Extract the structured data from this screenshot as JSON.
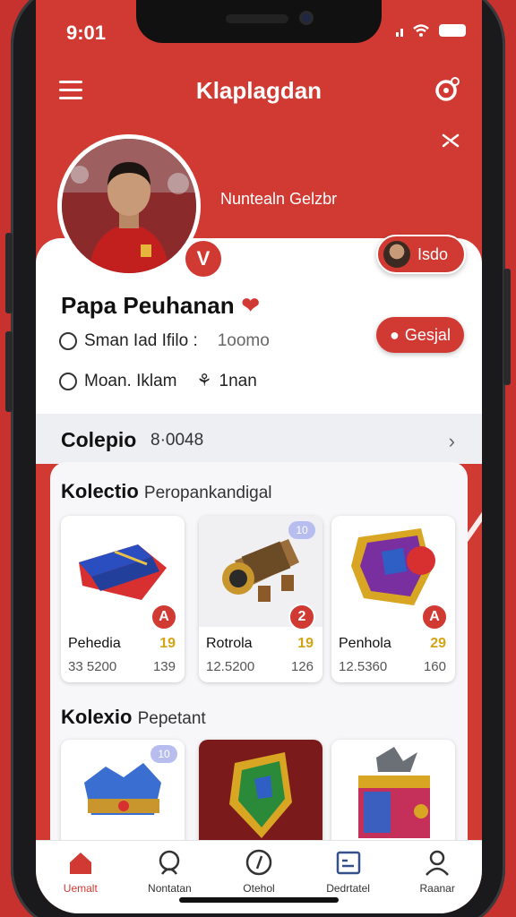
{
  "status_bar": {
    "time": "9:01"
  },
  "header": {
    "title": "Klaplagdan"
  },
  "profile": {
    "team_name": "Nuntealn Gelzbr",
    "badge_letter": "V",
    "mini_chip_label": "Isdo",
    "player_name": "Papa Peuhanan",
    "stat_line_1": "Sman Iad Ifilo :",
    "stat_line_1_value": "1oomo",
    "stat_line_2": "Moan. Iklam",
    "stat_line_2_value": "1nan",
    "follow_label": "Gesjal"
  },
  "section": {
    "title": "Colepio",
    "count": "8·0048"
  },
  "collections": [
    {
      "title": "Kolectio",
      "subtitle": "Peropankandigal",
      "items": [
        {
          "name": "Pehedia",
          "score": "19",
          "sub": "33 5200",
          "sub2": "139",
          "badge": "A",
          "tag": ""
        },
        {
          "name": "Rotrola",
          "score": "19",
          "sub": "12.5200",
          "sub2": "126",
          "badge": "2",
          "tag": "10"
        },
        {
          "name": "Penhola",
          "score": "29",
          "sub": "12.5360",
          "sub2": "160",
          "badge": "A",
          "tag": ""
        }
      ]
    },
    {
      "title": "Kolexio",
      "subtitle": "Pepetant",
      "items": [
        {
          "tag": "10"
        },
        {
          "tag": ""
        },
        {
          "tag": ""
        }
      ]
    }
  ],
  "bottom_nav": [
    {
      "label": "Uemalt",
      "icon": "home-icon",
      "active": true
    },
    {
      "label": "Nontatan",
      "icon": "search-icon",
      "active": false
    },
    {
      "label": "Otehol",
      "icon": "compass-icon",
      "active": false
    },
    {
      "label": "Dedrtatel",
      "icon": "calendar-icon",
      "active": false
    },
    {
      "label": "Raanar",
      "icon": "user-icon",
      "active": false
    }
  ],
  "colors": {
    "accent": "#d13a33",
    "gold": "#d4a417",
    "background": "#eeeff2"
  }
}
